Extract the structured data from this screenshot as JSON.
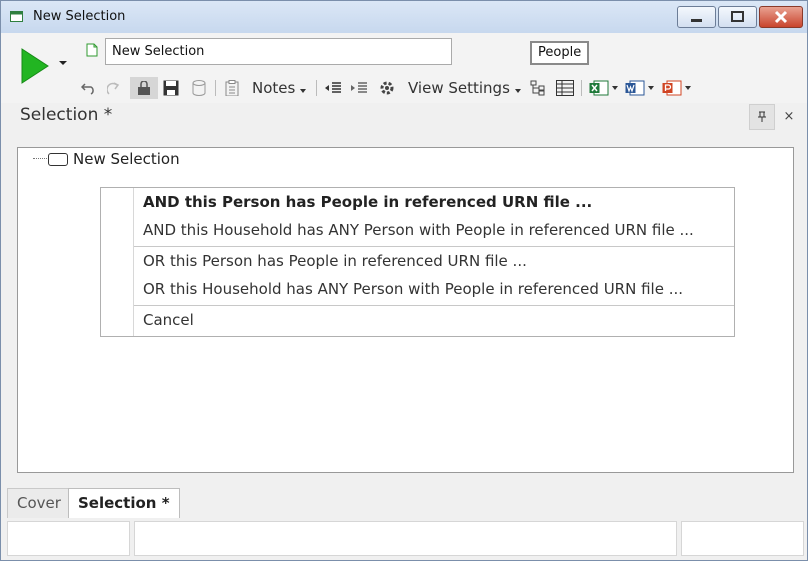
{
  "window": {
    "title": "New Selection",
    "title_icon": "window-icon",
    "controls": {
      "minimize_icon": "minimize-icon",
      "maximize_icon": "maximize-icon",
      "close_icon": "close-icon"
    }
  },
  "toolbar": {
    "run_icon": "play-icon",
    "selection_name": "New Selection",
    "people_label": "People",
    "notes_label": "Notes",
    "view_settings_label": "View Settings",
    "colors": {
      "run": "#22b522",
      "excel": "#1f7a3a",
      "word": "#2b5797",
      "powerpoint": "#d04423"
    }
  },
  "panel": {
    "title": "Selection *",
    "pin_label": "⊤",
    "close_label": "×"
  },
  "tree": {
    "root_label": "New Selection"
  },
  "context_menu": {
    "items": [
      {
        "label": "AND this Person has People in referenced URN file ..."
      },
      {
        "label": "AND this Household has ANY Person with People in referenced URN file ..."
      },
      {
        "label": "OR this Person has People in referenced URN file ..."
      },
      {
        "label": "OR this Household has ANY Person with People in referenced URN file ..."
      },
      {
        "label": "Cancel"
      }
    ]
  },
  "tabs": [
    {
      "label": "Cover",
      "active": false
    },
    {
      "label": "Selection *",
      "active": true
    }
  ]
}
